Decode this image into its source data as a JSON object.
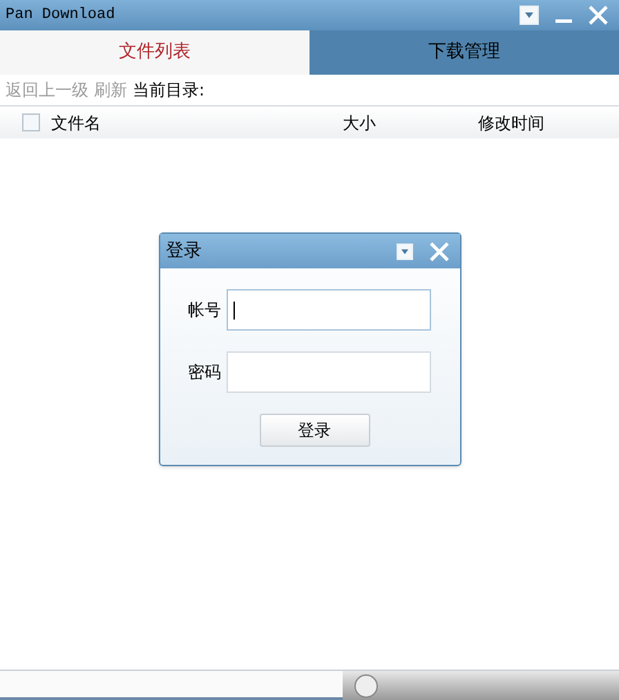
{
  "window": {
    "title": "Pan Download"
  },
  "tabs": [
    {
      "label": "文件列表",
      "selected": true
    },
    {
      "label": "下载管理",
      "selected": false
    }
  ],
  "toolbar": {
    "back": "返回上一级",
    "refresh": "刷新",
    "current_dir_label": "当前目录:"
  },
  "table": {
    "select_all_checked": false,
    "columns": [
      "文件名",
      "大小",
      "修改时间"
    ]
  },
  "login_dialog": {
    "title": "登录",
    "fields": [
      {
        "label": "帐号",
        "focused": true
      },
      {
        "label": "密码",
        "focused": false
      }
    ],
    "submit": "登录"
  }
}
